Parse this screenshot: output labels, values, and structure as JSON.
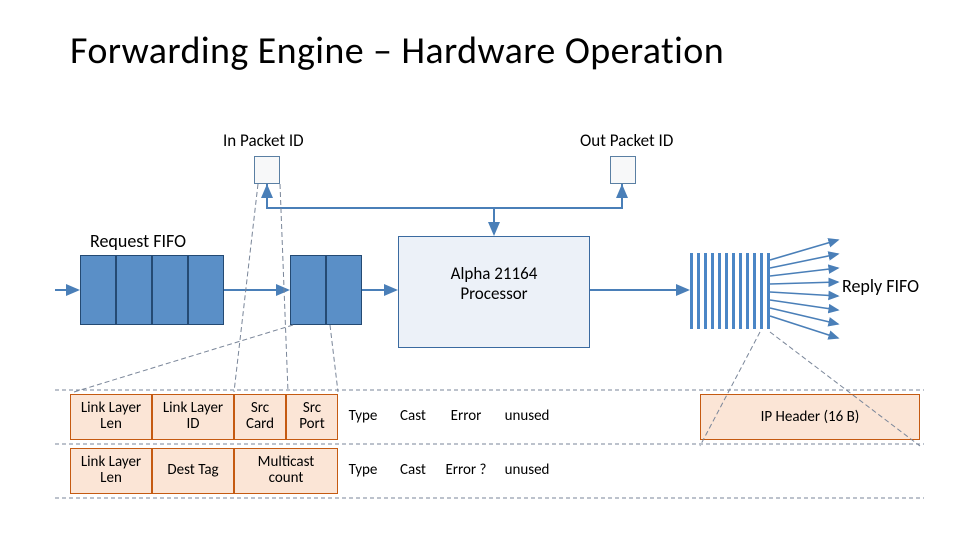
{
  "title": "Forwarding Engine – Hardware Operation",
  "labels": {
    "in_packet": "In Packet ID",
    "out_packet": "Out Packet ID",
    "request_fifo": "Request FIFO",
    "reply_fifo": "Reply FIFO",
    "processor": "Alpha 21164 Processor",
    "ip_header": "IP Header (16 B)"
  },
  "row1": {
    "c0": "Link Layer Len",
    "c1": "Link Layer ID",
    "c2": "Src Card",
    "c3": "Src Port",
    "c4": "Type",
    "c5": "Cast",
    "c6": "Error",
    "c7": "unused"
  },
  "row2": {
    "c0": "Link Layer Len",
    "c1": "Dest Tag",
    "c2": "Multicast count",
    "c3": "Type",
    "c4": "Cast",
    "c5": "Error ?",
    "c6": "unused"
  },
  "colors": {
    "fifo_fill": "#5a8fc7",
    "fifo_stroke": "#244a73",
    "table_fill": "#fbe5d6",
    "table_stroke": "#c55a11",
    "processor_fill": "#ecf1f8",
    "processor_stroke": "#3a6aa0",
    "arrow": "#4a7fb8"
  }
}
